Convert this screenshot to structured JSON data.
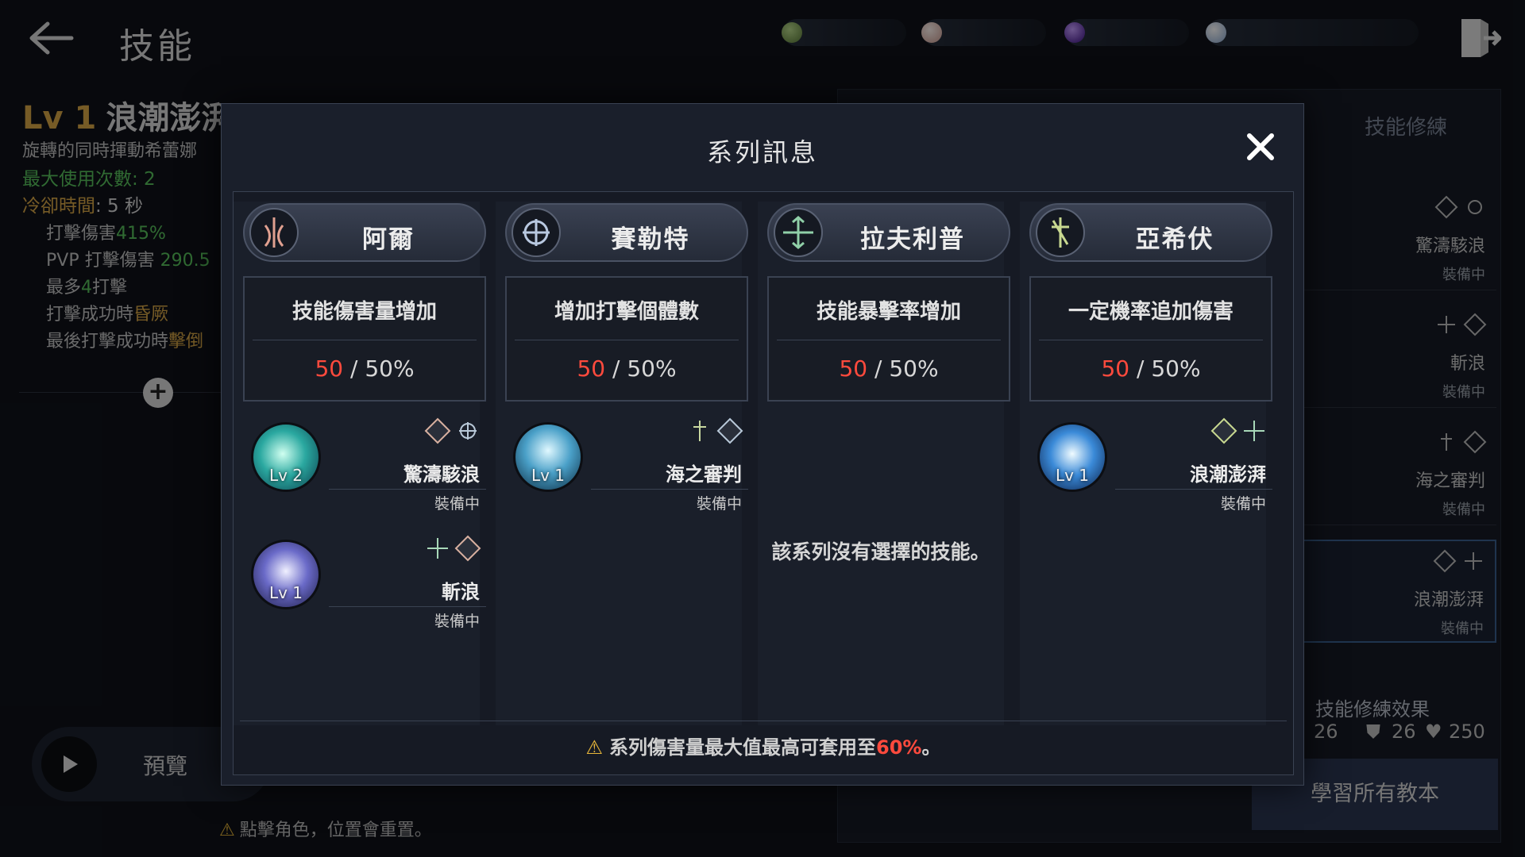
{
  "header": {
    "title": "技能",
    "currencies": [
      {
        "icon": "green-gem-icon",
        "color": "#7fa35a",
        "value": ""
      },
      {
        "icon": "pearl-icon",
        "color": "#e8c8c0",
        "value": ""
      },
      {
        "icon": "purple-orb-icon",
        "color": "#7a3ad0",
        "value": ""
      },
      {
        "icon": "silver-coin-icon",
        "color": "#c8d8ee",
        "value": ""
      }
    ]
  },
  "skill_info": {
    "level": "Lv 1",
    "name": "浪潮澎湃",
    "description": "旋轉的同時揮動希蕾娜",
    "max_uses": "最大使用次數: 2",
    "cooldown_label": "冷卻時間",
    "cooldown_value": ": 5 秒",
    "hit_damage_label": "打擊傷害",
    "hit_damage_value": "415%",
    "pvp_damage_label": "PVP 打擊傷害",
    "pvp_damage_value": "290.5",
    "max_hits_pre": "最多",
    "max_hits_num": "4",
    "max_hits_post": "打擊",
    "on_hit_pre": "打擊成功時",
    "on_hit_effect": "昏厥",
    "last_hit_pre": "最後打擊成功時",
    "last_hit_effect": "擊倒"
  },
  "preview": {
    "label": "預覽"
  },
  "bottom_hint": "點擊角色，位置會重置。",
  "right_panel": {
    "tab_training": "技能修練",
    "items": [
      {
        "name": "驚濤駭浪",
        "state": "裝備中"
      },
      {
        "name": "斬浪",
        "state": "裝備中"
      },
      {
        "name": "海之審判",
        "state": "裝備中"
      },
      {
        "name": "浪潮澎湃",
        "state": "裝備中"
      }
    ],
    "effects_title": "技能修練效果",
    "stats": [
      "26",
      "26",
      "250"
    ],
    "learn_all": "學習所有教本"
  },
  "modal": {
    "title": "系列訊息",
    "columns": [
      {
        "name": "阿爾",
        "icon": "flame-emblem-icon",
        "bonus_title": "技能傷害量增加",
        "bonus_current": "50",
        "bonus_max": " / 50%",
        "skills": [
          {
            "name": "驚濤駭浪",
            "level": "Lv 2",
            "state": "裝備中"
          },
          {
            "name": "斬浪",
            "level": "Lv 1",
            "state": "裝備中"
          }
        ],
        "empty": ""
      },
      {
        "name": "賽勒特",
        "icon": "compass-emblem-icon",
        "bonus_title": "增加打擊個體數",
        "bonus_current": "50",
        "bonus_max": " / 50%",
        "skills": [
          {
            "name": "海之審判",
            "level": "Lv 1",
            "state": "裝備中"
          }
        ],
        "empty": ""
      },
      {
        "name": "拉夫利普",
        "icon": "arrows-emblem-icon",
        "bonus_title": "技能暴擊率增加",
        "bonus_current": "50",
        "bonus_max": " / 50%",
        "skills": [],
        "empty": "該系列沒有選擇的技能。"
      },
      {
        "name": "亞希伏",
        "icon": "cross-emblem-icon",
        "bonus_title": "一定機率追加傷害",
        "bonus_current": "50",
        "bonus_max": " / 50%",
        "skills": [
          {
            "name": "浪潮澎湃",
            "level": "Lv 1",
            "state": "裝備中"
          }
        ],
        "empty": ""
      }
    ],
    "note_pre": "系列傷害量最大值最高可套用至",
    "note_value": "60%",
    "note_post": "。"
  }
}
